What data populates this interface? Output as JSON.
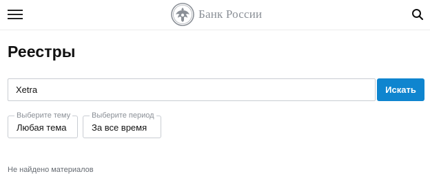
{
  "header": {
    "logo_text": "Банк России",
    "menu_icon": "hamburger-menu-icon",
    "search_icon": "search-icon"
  },
  "page": {
    "title": "Реестры"
  },
  "search": {
    "value": "Xetra",
    "button_label": "Искать"
  },
  "filters": {
    "topic": {
      "label": "Выберите тему",
      "value": "Любая тема"
    },
    "period": {
      "label": "Выберите период",
      "value": "За все время"
    }
  },
  "results": {
    "message": "Не найдено материалов"
  },
  "colors": {
    "accent": "#0f85cf",
    "logo_gray": "#8a8f96",
    "border": "#c8ccd2"
  }
}
